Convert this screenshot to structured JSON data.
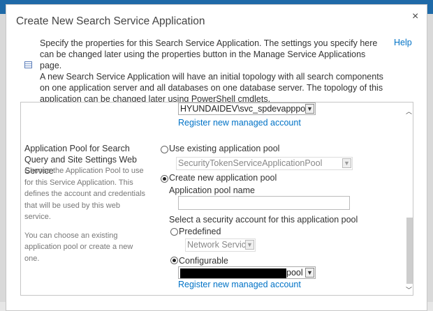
{
  "dialog": {
    "title": "Create New Search Service Application",
    "close": "×",
    "help": "Help",
    "description": "Specify the properties for this Search Service Application. The settings you specify here can be changed later using the properties button in the Manage Service Applications page.",
    "description2": "A new Search Service Application will have an initial topology with all search components on one application server and all databases on one database server. The topology of this application can be changed later using PowerShell cmdlets."
  },
  "top_account": {
    "value": "HYUNDAIDEV\\svc_spdevapppool",
    "link": "Register new managed account"
  },
  "section": {
    "heading": "Application Pool for Search Query and Site Settings Web Service",
    "desc1": "Choose the Application Pool to use for this Service Application.  This defines the account and credentials that will be used by this web service.",
    "desc2": "You can choose an existing application pool or create a new one."
  },
  "pool": {
    "use_existing_label": "Use existing application pool",
    "existing_value": "SecurityTokenServiceApplicationPool",
    "create_new_label": "Create new application pool",
    "name_label": "Application pool name",
    "name_value": "",
    "security_label": "Select a security account for this application pool",
    "predefined_label": "Predefined",
    "predefined_value": "Network Service",
    "configurable_label": "Configurable",
    "configurable_value": "pool",
    "link": "Register new managed account"
  }
}
